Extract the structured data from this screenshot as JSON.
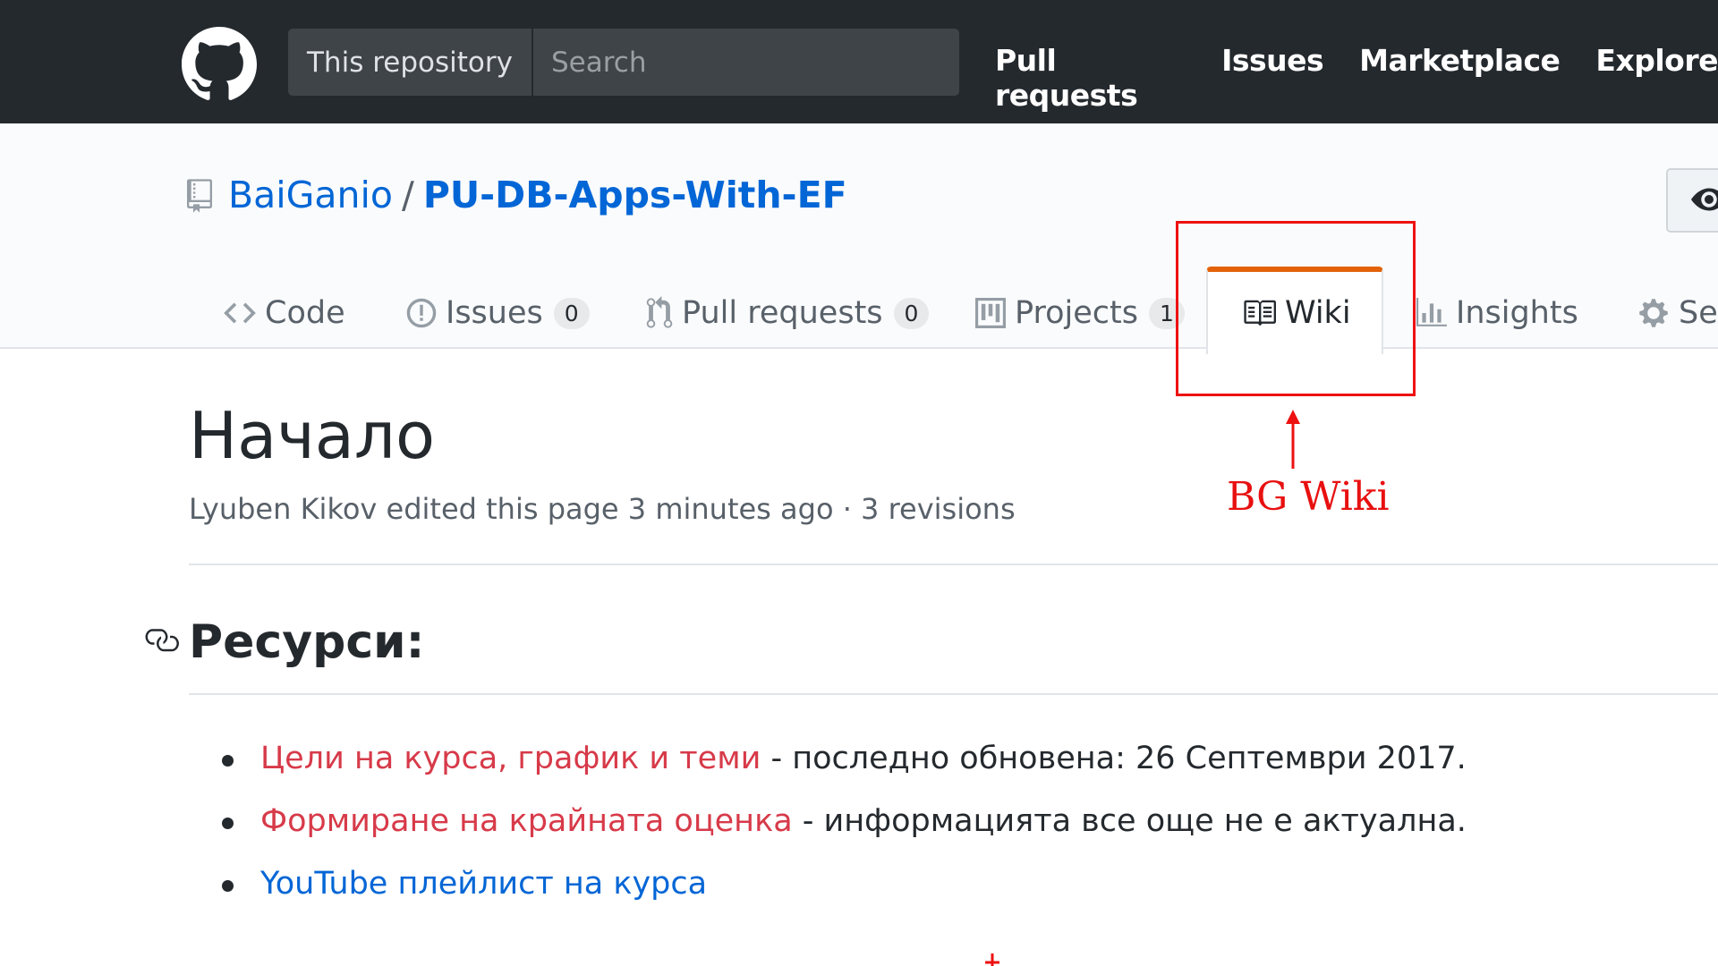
{
  "header": {
    "search_scope": "This repository",
    "search_placeholder": "Search",
    "nav": [
      "Pull requests",
      "Issues",
      "Marketplace",
      "Explore"
    ]
  },
  "repo": {
    "owner": "BaiGanio",
    "separator": "/",
    "name": "PU-DB-Apps-With-EF"
  },
  "tabs": {
    "code": {
      "label": "Code"
    },
    "issues": {
      "label": "Issues",
      "count": "0"
    },
    "pull_requests": {
      "label": "Pull requests",
      "count": "0"
    },
    "projects": {
      "label": "Projects",
      "count": "1"
    },
    "wiki": {
      "label": "Wiki",
      "selected": true
    },
    "insights": {
      "label": "Insights"
    },
    "settings": {
      "label": "Set"
    }
  },
  "annotation": {
    "label": "BG Wiki",
    "color": "#ee1111"
  },
  "page": {
    "title": "Начало",
    "meta": "Lyuben Kikov edited this page 3 minutes ago · 3 revisions",
    "section_title": "Ресурси:",
    "resources": [
      {
        "link": "Цели на курса, график и теми",
        "rest": " - последно обновена: 26 Септември 2017."
      },
      {
        "link": "Формиране на крайната оценка",
        "rest": " - информацията все още не е актуална."
      },
      {
        "link": "YouTube плейлист на курса",
        "rest": ""
      }
    ]
  },
  "colors": {
    "header_bg": "#24292e",
    "link_blue": "#0366d6",
    "link_red": "#d73a49",
    "tab_accent": "#e36209"
  }
}
